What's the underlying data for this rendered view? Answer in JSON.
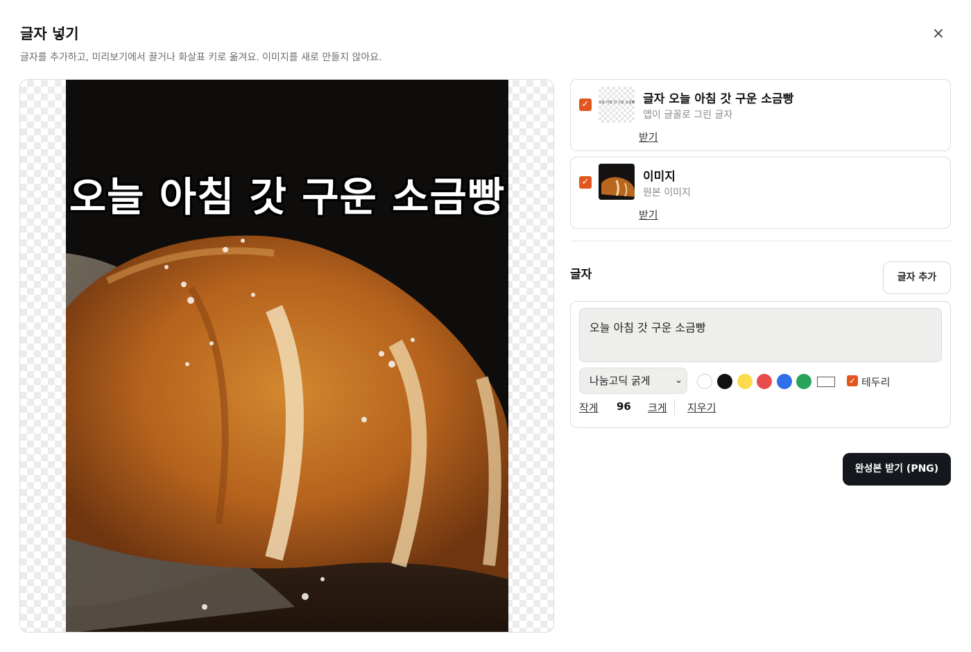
{
  "dialog": {
    "title": "글자 넣기",
    "subtitle": "글자를 추가하고, 미리보기에서 끌거나 화살표 키로 옮겨요. 이미지를 새로 만들지 않아요.",
    "close_symbol": "×"
  },
  "preview": {
    "overlay_text": "오늘 아침 갓 구운 소금빵",
    "text_color": "#ffffff",
    "outline_color": "#000000"
  },
  "layers": [
    {
      "checked": true,
      "title": "글자 오늘 아침 갓 구운 소금빵",
      "subtitle": "앱이 글꼴로 그린 글자",
      "thumb_text": "오늘 아침 갓 구운 소금빵",
      "link": "받기"
    },
    {
      "checked": true,
      "title": "이미지",
      "subtitle": "원본 이미지",
      "link": "받기"
    }
  ],
  "text_section": {
    "label": "글자",
    "add_button": "글자 추가",
    "text_value": "오늘 아침 갓 구운 소금빵",
    "font": "나눔고딕 굵게",
    "colors": [
      "#ffffff",
      "#111111",
      "#fcdc4d",
      "#e94b4b",
      "#2f6fe8",
      "#27a35a"
    ],
    "border_checked": true,
    "border_label": "테두리",
    "smaller_label": "작게",
    "size": "96",
    "larger_label": "크게",
    "delete_label": "지우기"
  },
  "export_button": "완성본 받기 (PNG)",
  "accent_color": "#e2551f"
}
